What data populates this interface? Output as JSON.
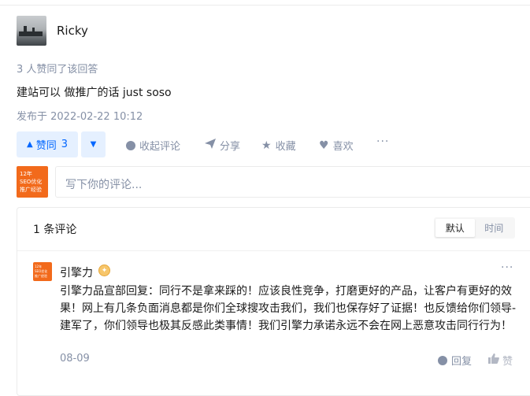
{
  "answer": {
    "author_name": "Ricky",
    "votes_info": "3 人赞同了该回答",
    "text": "建站可以 做推广的话 just soso",
    "publish_time": "发布于 2022-02-22 10:12"
  },
  "actions": {
    "upvote_label": "赞同",
    "upvote_count": "3",
    "collapse_comments": "收起评论",
    "share": "分享",
    "favorite": "收藏",
    "like": "喜欢",
    "more": "···"
  },
  "comment_box": {
    "placeholder": "写下你的评论...",
    "avatar_lines": [
      "12年",
      "SEO优化",
      "推广经验"
    ]
  },
  "comments_panel": {
    "count_label": "1 条评论",
    "sort_default": "默认",
    "sort_time": "时间"
  },
  "comment": {
    "author": "引擎力",
    "badge": "✦",
    "avatar_lines": [
      "12年",
      "SEO优化",
      "推广经验"
    ],
    "text": "引擎力品宣部回复：同行不是拿来踩的！应该良性竞争，打磨更好的产品，让客户有更好的效果！网上有几条负面消息都是你们全球搜攻击我们，我们也保存好了证据！也反馈给你们领导-建军了，你们领导也极其反感此类事情！我们引擎力承诺永远不会在网上恶意攻击同行行为！",
    "date": "08-09",
    "reply": "回复",
    "like": "赞",
    "more": "···"
  },
  "colors": {
    "accent": "#0066ff",
    "accent_bg": "#e5f0ff",
    "muted": "#8590a6",
    "brand_orange": "#f26a1b"
  }
}
